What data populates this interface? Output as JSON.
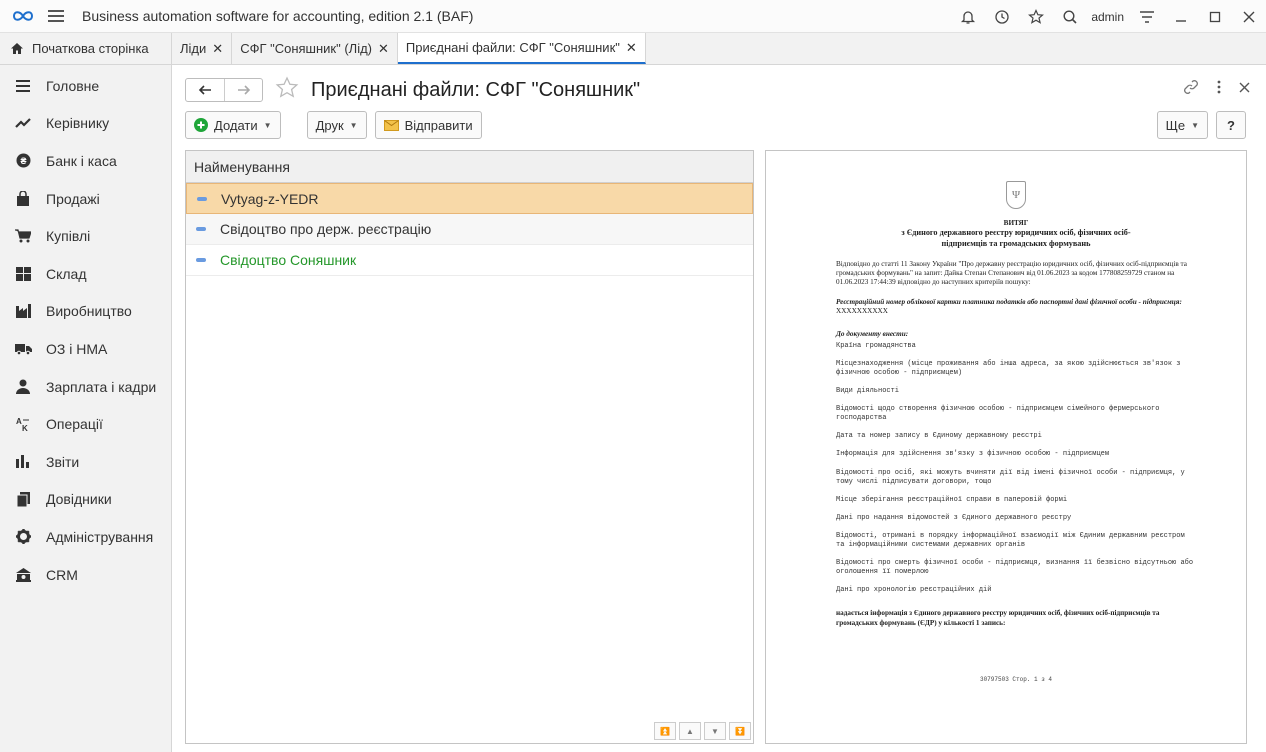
{
  "app": {
    "title": "Business automation software for accounting, edition 2.1  (BAF)",
    "user": "admin"
  },
  "tabs": [
    {
      "label": "Початкова сторінка",
      "close": ""
    },
    {
      "label": "Ліди",
      "close": "✕"
    },
    {
      "label": "СФГ \"Соняшник\" (Лід)",
      "close": "✕"
    },
    {
      "label": "Приєднані файли: СФГ \"Соняшник\"",
      "close": "✕"
    }
  ],
  "sidebar": {
    "items": [
      {
        "label": "Головне",
        "icon": "menu-icon"
      },
      {
        "label": "Керівнику",
        "icon": "trend-icon"
      },
      {
        "label": "Банк і каса",
        "icon": "coin-icon"
      },
      {
        "label": "Продажі",
        "icon": "bag-icon"
      },
      {
        "label": "Купівлі",
        "icon": "cart-icon"
      },
      {
        "label": "Склад",
        "icon": "warehouse-icon"
      },
      {
        "label": "Виробництво",
        "icon": "factory-icon"
      },
      {
        "label": "ОЗ і НМА",
        "icon": "truck-icon"
      },
      {
        "label": "Зарплата і кадри",
        "icon": "person-icon"
      },
      {
        "label": "Операції",
        "icon": "operations-icon"
      },
      {
        "label": "Звіти",
        "icon": "chart-icon"
      },
      {
        "label": "Довідники",
        "icon": "books-icon"
      },
      {
        "label": "Адміністрування",
        "icon": "gear-icon"
      },
      {
        "label": "CRM",
        "icon": "crm-icon"
      }
    ]
  },
  "page": {
    "title": "Приєднані файли: СФГ \"Соняшник\""
  },
  "toolbar": {
    "add": "Додати",
    "print": "Друк",
    "send": "Відправити",
    "more": "Ще",
    "help": "?"
  },
  "list": {
    "header": "Найменування",
    "rows": [
      {
        "name": "Vytyag-z-YEDR"
      },
      {
        "name": "Свідоцтво про держ. реєстрацію"
      },
      {
        "name": "Свідоцтво Соняшник"
      }
    ]
  },
  "preview": {
    "title": "ВИТЯГ",
    "subtitle1": "з Єдиного державного реєстру юридичних осіб, фізичних осіб-",
    "subtitle2": "підприємців та громадських формувань",
    "intro": "Відповідно до статті 11 Закону України \"Про державну реєстрацію юридичних осіб, фізичних осіб-підприємців та громадських формувань\" на запит: Дайка Степан Степанович від 01.06.2023 за кодом 177808259729 станом на 01.06.2023 17:44:39 відповідно до наступних критеріїв пошуку:",
    "criteria_label": "Реєстраційний номер облікової картки платника податків або паспортні дані фізичної особи - підприємця:",
    "criteria_value": "XXXXXXXXXX",
    "include_label": "До документу внести:",
    "items": [
      "Країна громадянства",
      "Місцезнаходження (місце проживання або інша адреса, за якою здійснюється зв'язок з фізичною особою - підприємцем)",
      "Види діяльності",
      "Відомості щодо створення фізичною особою - підприємцем сімейного фермерського господарства",
      "Дата та номер запису в Єдиному державному реєстрі",
      "Інформація для здійснення зв'язку з фізичною особою - підприємцем",
      "Відомості про осіб, які можуть вчиняти дії від імені фізичної особи - підприємця, у тому числі підписувати договори, тощо",
      "Місце зберігання реєстраційної справи в паперовій формі",
      "Дані про надання відомостей з Єдиного державного реєстру",
      "Відомості, отримані в порядку інформаційної взаємодії між Єдиним державним реєстром та інформаційними системами державних органів",
      "Відомості про смерть фізичної особи - підприємця, визнання її безвісно відсутньою або оголошення її померлою",
      "Дані про хронологію реєстраційних дій"
    ],
    "closing": "надається інформація з Єдиного державного реєстру юридичних осіб, фізичних осіб-підприємців та громадських формувань (ЄДР) у кількості 1 запись:",
    "footer": "30797503 Стор. 1 з 4"
  }
}
